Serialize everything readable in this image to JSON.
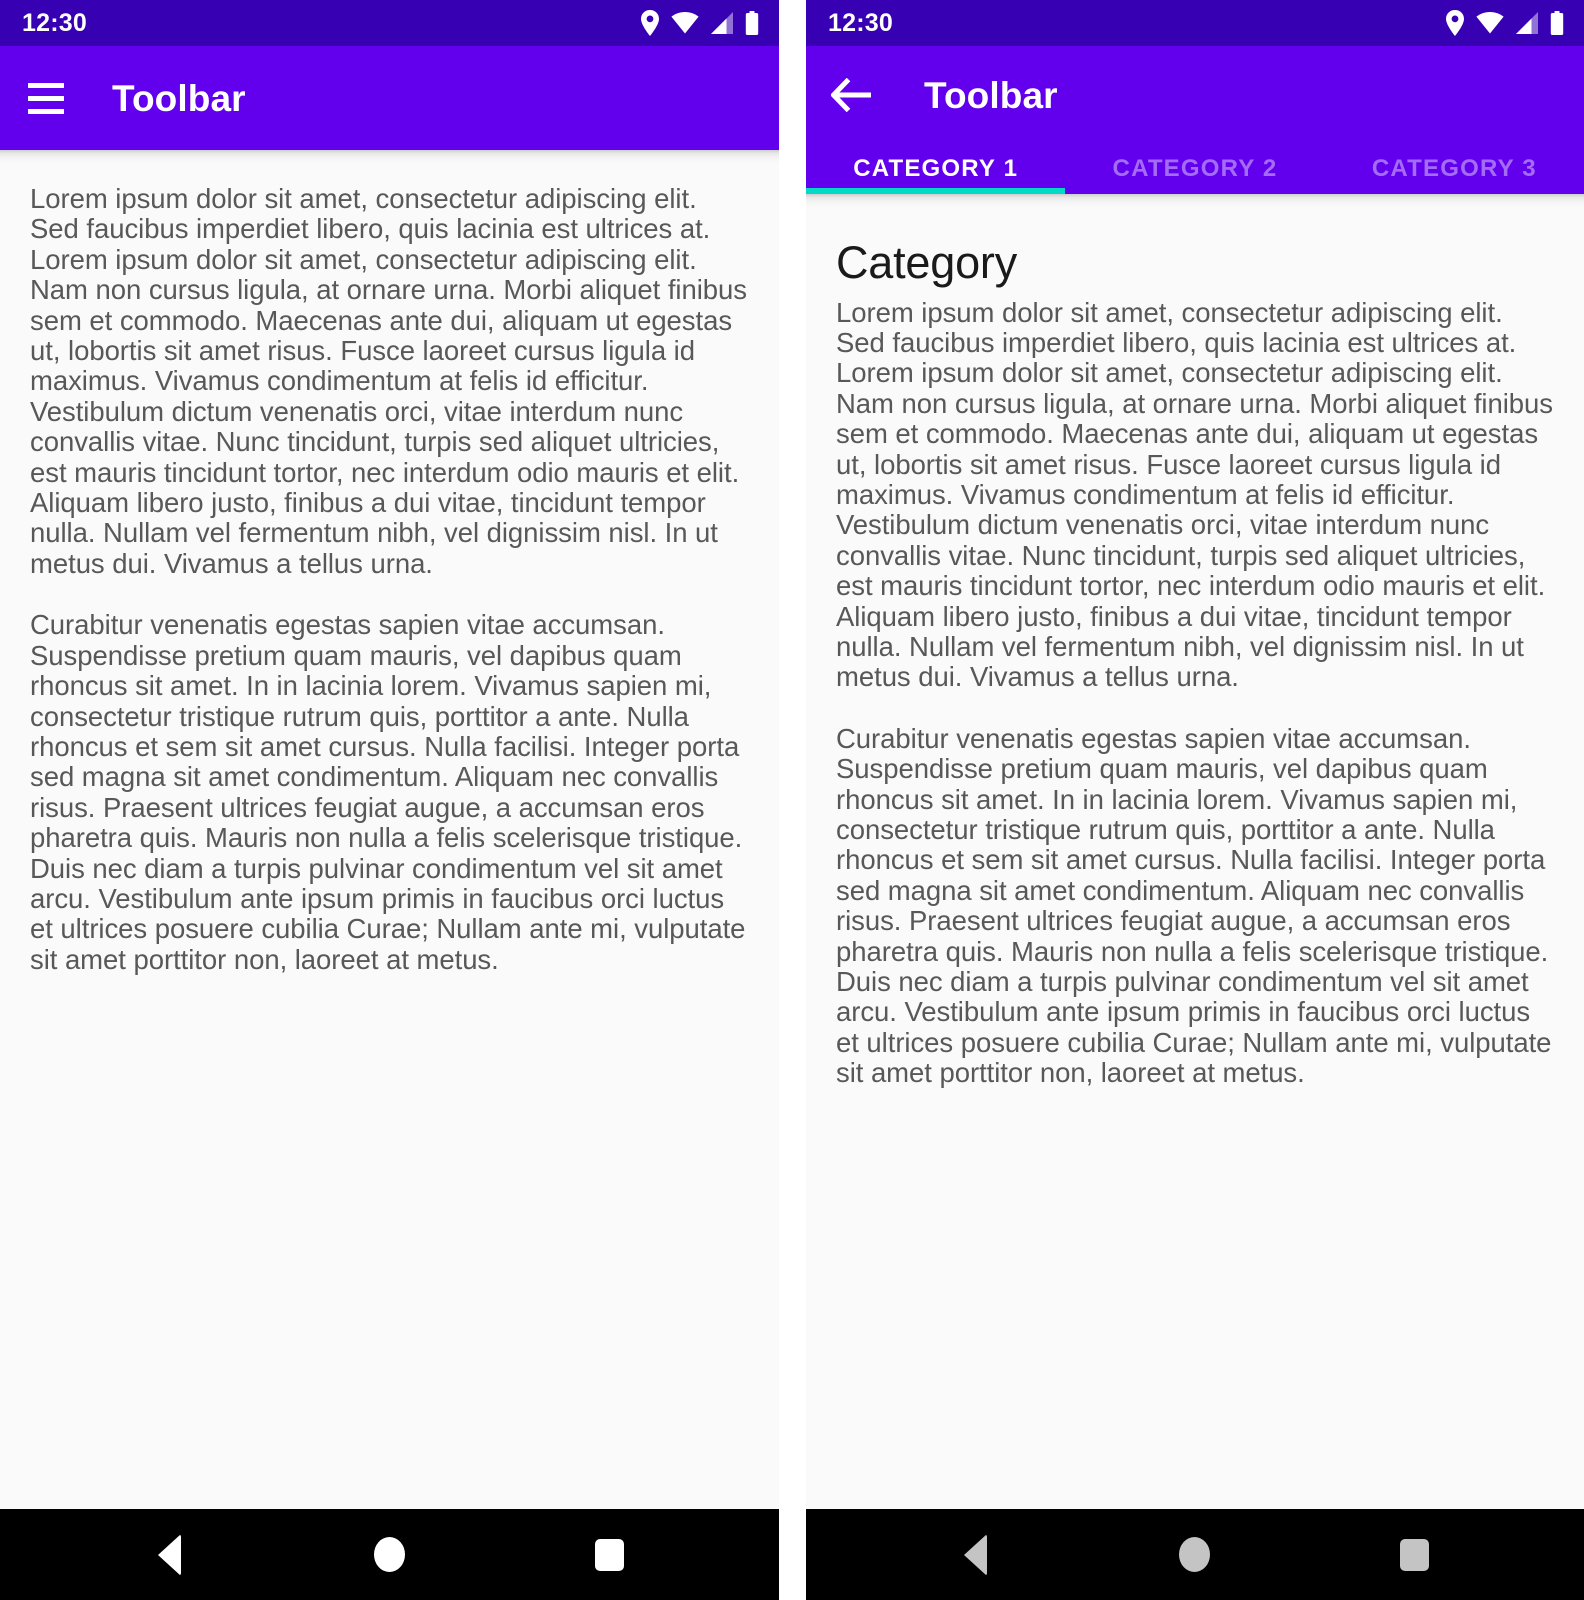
{
  "shared": {
    "status_bar": {
      "time": "12:30",
      "icons": [
        "location-pin-icon",
        "wifi-icon",
        "cellular-signal-icon",
        "battery-icon"
      ],
      "background": "#3700B3"
    },
    "system_nav": {
      "buttons": [
        "back-triangle-icon",
        "home-circle-icon",
        "recents-square-icon"
      ],
      "background": "#000000"
    },
    "colors": {
      "toolbar": "#6200EE",
      "status_bar": "#3700B3",
      "tab_indicator": "#03DAC5",
      "content_background": "#FAFAFA",
      "body_text": "#585858",
      "heading_text": "#1A1A1A"
    },
    "paragraphs": [
      "Lorem ipsum dolor sit amet, consectetur adipiscing elit. Sed faucibus imperdiet libero, quis lacinia est ultrices at. Lorem ipsum dolor sit amet, consectetur adipiscing elit. Nam non cursus ligula, at ornare urna. Morbi aliquet finibus sem et commodo. Maecenas ante dui, aliquam ut egestas ut, lobortis sit amet risus. Fusce laoreet cursus ligula id maximus. Vivamus condimentum at felis id efficitur. Vestibulum dictum venenatis orci, vitae interdum nunc convallis vitae. Nunc tincidunt, turpis sed aliquet ultricies, est mauris tincidunt tortor, nec interdum odio mauris et elit. Aliquam libero justo, finibus a dui vitae, tincidunt tempor nulla. Nullam vel fermentum nibh, vel dignissim nisl. In ut metus dui. Vivamus a tellus urna.",
      "Curabitur venenatis egestas sapien vitae accumsan. Suspendisse pretium quam mauris, vel dapibus quam rhoncus sit amet. In in lacinia lorem. Vivamus sapien mi, consectetur tristique rutrum quis, porttitor a ante. Nulla rhoncus et sem sit amet cursus. Nulla facilisi. Integer porta sed magna sit amet condimentum. Aliquam nec convallis risus. Praesent ultrices feugiat augue, a accumsan eros pharetra quis. Mauris non nulla a felis scelerisque tristique. Duis nec diam a turpis pulvinar condimentum vel sit amet arcu. Vestibulum ante ipsum primis in faucibus orci luctus et ultrices posuere cubilia Curae; Nullam ante mi, vulputate sit amet porttitor non, laoreet at metus."
    ]
  },
  "left_screen": {
    "toolbar": {
      "nav_icon": "hamburger-menu-icon",
      "title": "Toolbar"
    }
  },
  "right_screen": {
    "toolbar": {
      "nav_icon": "arrow-back-icon",
      "title": "Toolbar"
    },
    "tabs": [
      {
        "label": "CATEGORY 1",
        "active": true
      },
      {
        "label": "CATEGORY 2",
        "active": false
      },
      {
        "label": "CATEGORY 3",
        "active": false
      }
    ],
    "heading": "Category"
  }
}
